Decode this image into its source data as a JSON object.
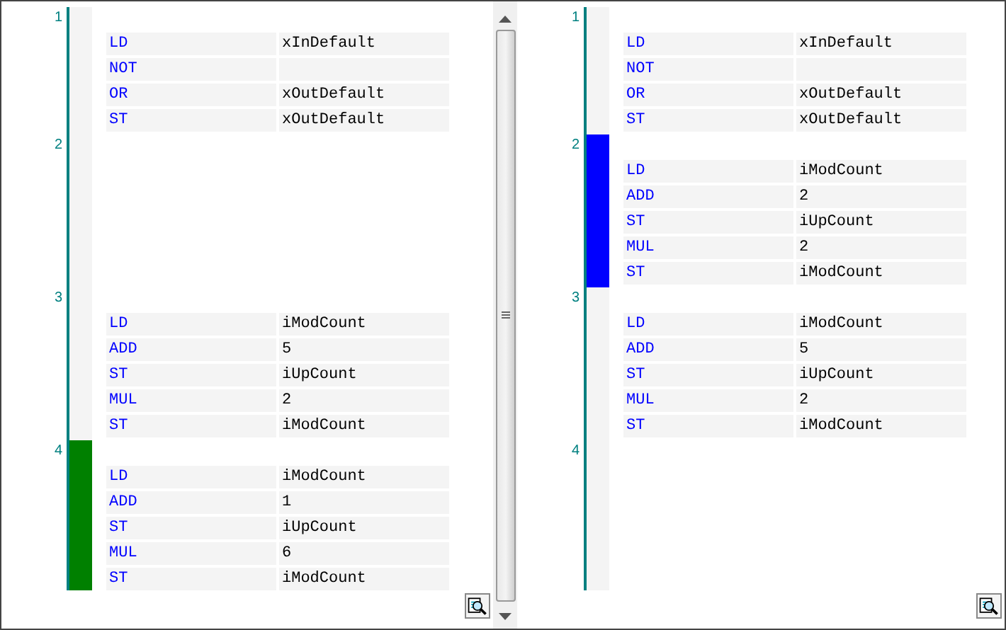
{
  "panes": [
    {
      "scrollbar": true,
      "networks": [
        {
          "number": "1",
          "rows": [
            {
              "op": "LD",
              "operand": "xInDefault"
            },
            {
              "op": "NOT"
            },
            {
              "op": "OR",
              "operand": "xOutDefault"
            },
            {
              "op": "ST",
              "operand": "xOutDefault"
            }
          ]
        },
        {
          "number": "2"
        },
        {
          "number": "3",
          "rows": [
            {
              "op": "LD",
              "operand": "iModCount"
            },
            {
              "op": "ADD",
              "operand": "5"
            },
            {
              "op": "ST",
              "operand": "iUpCount"
            },
            {
              "op": "MUL",
              "operand": "2"
            },
            {
              "op": "ST",
              "operand": "iModCount"
            }
          ]
        },
        {
          "number": "4",
          "color": "#008000",
          "rows": [
            {
              "op": "LD",
              "operand": "iModCount"
            },
            {
              "op": "ADD",
              "operand": "1"
            },
            {
              "op": "ST",
              "operand": "iUpCount"
            },
            {
              "op": "MUL",
              "operand": "6"
            },
            {
              "op": "ST",
              "operand": "iModCount"
            }
          ]
        }
      ]
    },
    {
      "scrollbar": false,
      "networks": [
        {
          "number": "1",
          "rows": [
            {
              "op": "LD",
              "operand": "xInDefault"
            },
            {
              "op": "NOT"
            },
            {
              "op": "OR",
              "operand": "xOutDefault"
            },
            {
              "op": "ST",
              "operand": "xOutDefault"
            }
          ]
        },
        {
          "number": "2",
          "color": "#0000ff",
          "rows": [
            {
              "op": "LD",
              "operand": "iModCount"
            },
            {
              "op": "ADD",
              "operand": "2"
            },
            {
              "op": "ST",
              "operand": "iUpCount"
            },
            {
              "op": "MUL",
              "operand": "2"
            },
            {
              "op": "ST",
              "operand": "iModCount"
            }
          ]
        },
        {
          "number": "3",
          "rows": [
            {
              "op": "LD",
              "operand": "iModCount"
            },
            {
              "op": "ADD",
              "operand": "5"
            },
            {
              "op": "ST",
              "operand": "iUpCount"
            },
            {
              "op": "MUL",
              "operand": "2"
            },
            {
              "op": "ST",
              "operand": "iModCount"
            }
          ]
        },
        {
          "number": "4"
        }
      ]
    }
  ]
}
